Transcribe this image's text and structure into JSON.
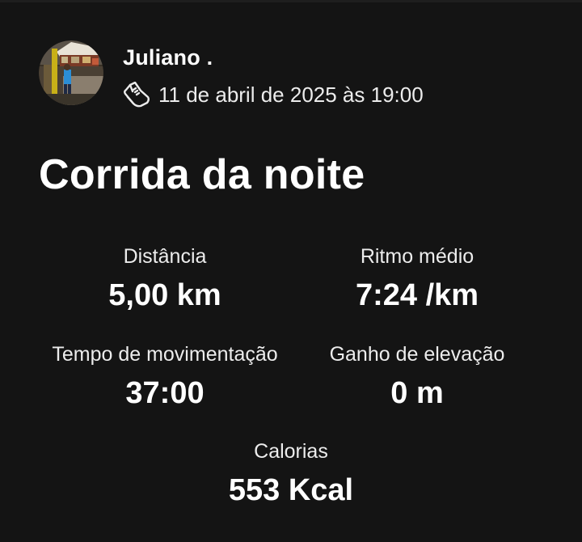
{
  "athlete": {
    "name": "Juliano ."
  },
  "activity": {
    "sport_icon": "running-shoe-icon",
    "date": "11 de abril de 2025 às 19:00",
    "title": "Corrida da noite"
  },
  "stats": {
    "distance": {
      "label": "Distância",
      "value": "5,00 km"
    },
    "pace": {
      "label": "Ritmo médio",
      "value": "7:24 /km"
    },
    "moving_time": {
      "label": "Tempo de movimentação",
      "value": "37:00"
    },
    "elevation_gain": {
      "label": "Ganho de elevação",
      "value": "0 m"
    },
    "calories": {
      "label": "Calorias",
      "value": "553 Kcal"
    }
  },
  "colors": {
    "background": "#141414",
    "text_primary": "#ffffff",
    "text_secondary": "#ececec"
  }
}
